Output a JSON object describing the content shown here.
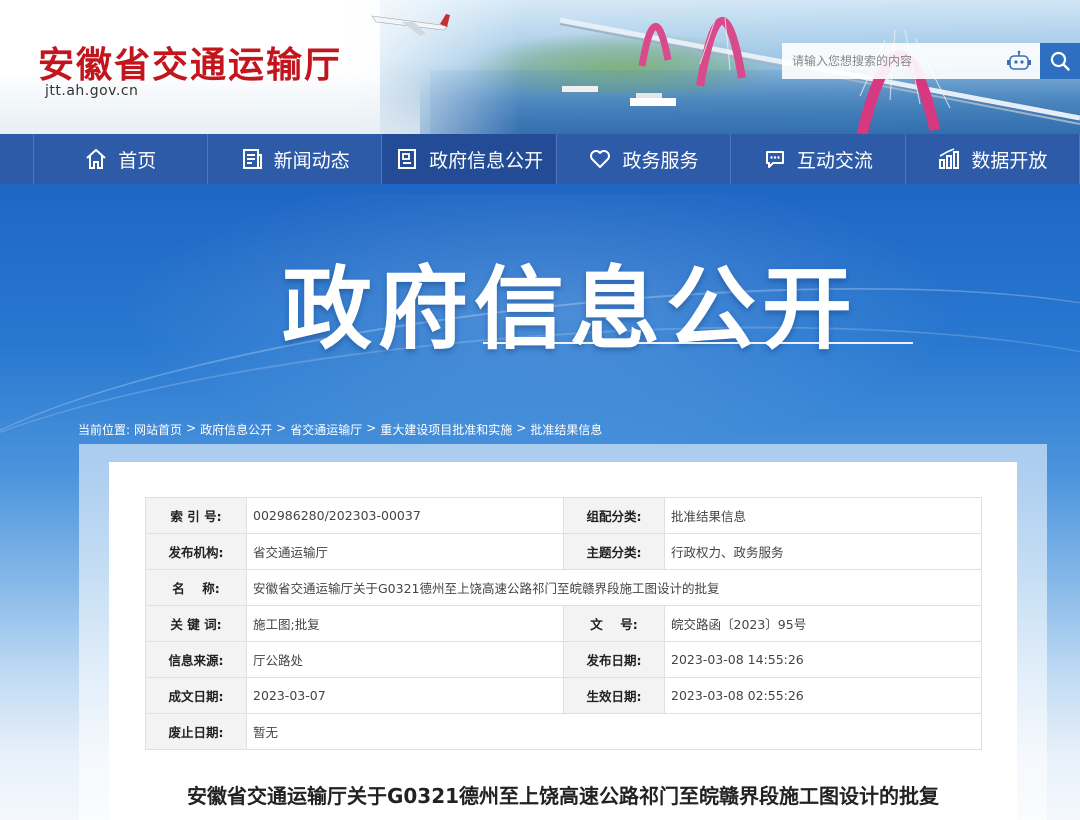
{
  "header": {
    "title": "安徽省交通运输厅",
    "url": "jtt.ah.gov.cn",
    "search_placeholder": "请输入您想搜索的内容",
    "icons": [
      "robot-icon",
      "search-icon"
    ]
  },
  "nav": {
    "items": [
      {
        "label": "首页",
        "icon": "home-icon"
      },
      {
        "label": "新闻动态",
        "icon": "news-icon"
      },
      {
        "label": "政府信息公开",
        "icon": "document-icon"
      },
      {
        "label": "政务服务",
        "icon": "heart-icon"
      },
      {
        "label": "互动交流",
        "icon": "chat-icon"
      },
      {
        "label": "数据开放",
        "icon": "chart-icon"
      }
    ],
    "active_index": 2
  },
  "hero": {
    "title": "政府信息公开"
  },
  "breadcrumb": {
    "prefix": "当前位置:",
    "items": [
      "网站首页",
      "政府信息公开",
      "省交通运输厅",
      "重大建设项目批准和实施",
      "批准结果信息"
    ],
    "separator": ">"
  },
  "meta": {
    "index_label": "索 引 号:",
    "index_value": "002986280/202303-00037",
    "category_label": "组配分类:",
    "category_value": "批准结果信息",
    "publisher_label": "发布机构:",
    "publisher_value": "省交通运输厅",
    "topic_label": "主题分类:",
    "topic_value": "行政权力、政务服务",
    "name_label": "名    称:",
    "name_value": "安徽省交通运输厅关于G0321德州至上饶高速公路祁门至皖赣界段施工图设计的批复",
    "keywords_label": "关 键 词:",
    "keywords_value": "施工图;批复",
    "docno_label": "文    号:",
    "docno_value": "皖交路函〔2023〕95号",
    "source_label": "信息来源:",
    "source_value": "厅公路处",
    "pubdate_label": "发布日期:",
    "pubdate_value": "2023-03-08 14:55:26",
    "created_label": "成文日期:",
    "created_value": "2023-03-07",
    "effective_label": "生效日期:",
    "effective_value": "2023-03-08 02:55:26",
    "expire_label": "废止日期:",
    "expire_value": "暂无"
  },
  "document": {
    "title": "安徽省交通运输厅关于G0321德州至上饶高速公路祁门至皖赣界段施工图设计的批复"
  },
  "colors": {
    "brand_red": "#c3151d",
    "nav_blue": "#2e5ba8",
    "nav_active": "#244c96",
    "hero_blue": "#1f66c4"
  }
}
